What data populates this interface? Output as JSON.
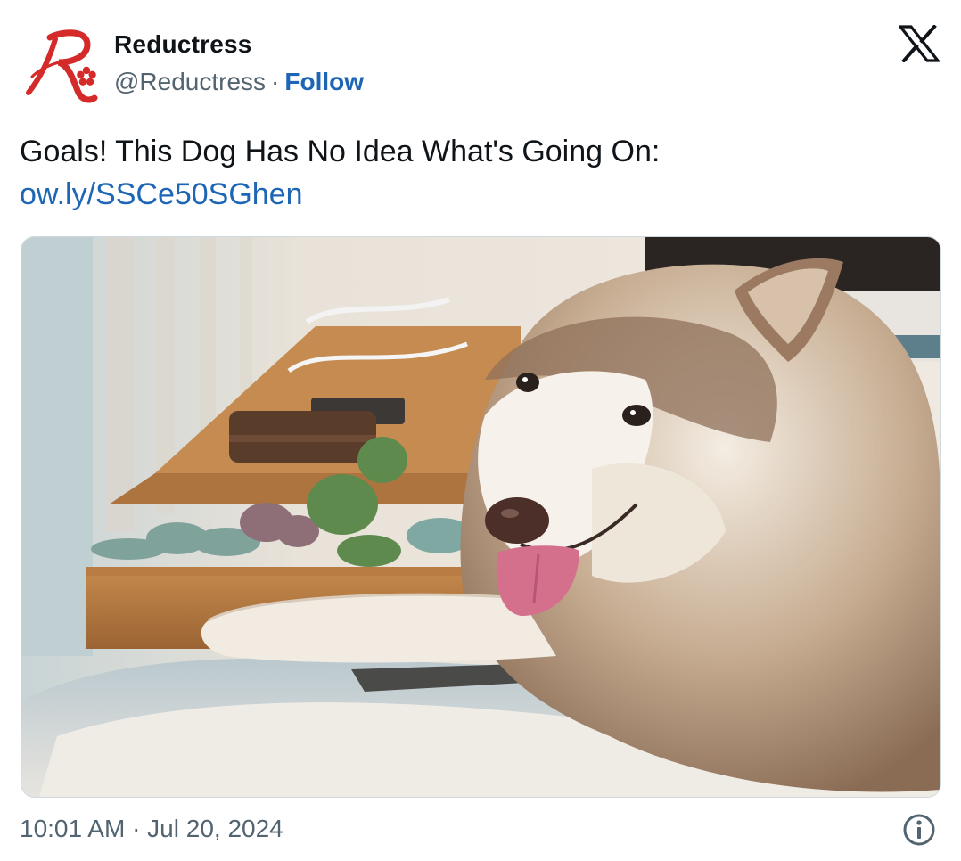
{
  "tweet": {
    "author": {
      "display_name": "Reductress",
      "handle": "@Reductress",
      "separator": "·",
      "follow_label": "Follow",
      "avatar_icon": "reductress-logo-icon"
    },
    "text": "Goals! This Dog Has No Idea What's Going On:",
    "link": "ow.ly/SSCe50SGhen",
    "timestamp": "10:01 AM · Jul 20, 2024",
    "icons": {
      "platform": "x-logo-icon",
      "info": "info-icon"
    },
    "colors": {
      "link": "#1d65b5",
      "secondary_text": "#536471",
      "brand_red": "#d42a2a"
    }
  }
}
